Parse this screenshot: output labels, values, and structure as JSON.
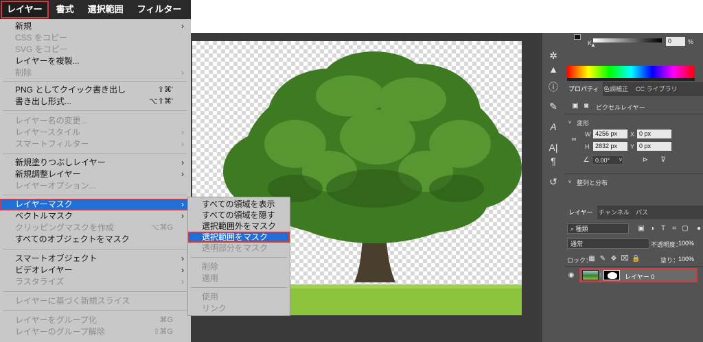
{
  "menubar": [
    "レイヤー",
    "書式",
    "選択範囲",
    "フィルター"
  ],
  "menu": {
    "items": [
      {
        "label": "新規",
        "shortcut": "",
        "arrow": true,
        "disabled": false
      },
      {
        "label": "CSS をコピー",
        "shortcut": "",
        "arrow": false,
        "disabled": true
      },
      {
        "label": "SVG をコピー",
        "shortcut": "",
        "arrow": false,
        "disabled": true
      },
      {
        "label": "レイヤーを複製...",
        "shortcut": "",
        "arrow": false,
        "disabled": false
      },
      {
        "label": "削除",
        "shortcut": "",
        "arrow": true,
        "disabled": true
      },
      {
        "label": "PNG としてクイック書き出し",
        "shortcut": "⇧⌘'",
        "arrow": false,
        "disabled": false
      },
      {
        "label": "書き出し形式...",
        "shortcut": "⌥⇧⌘'",
        "arrow": false,
        "disabled": false
      },
      {
        "label": "レイヤー名の変更...",
        "shortcut": "",
        "arrow": false,
        "disabled": true
      },
      {
        "label": "レイヤースタイル",
        "shortcut": "",
        "arrow": true,
        "disabled": true
      },
      {
        "label": "スマートフィルター",
        "shortcut": "",
        "arrow": true,
        "disabled": true
      },
      {
        "label": "新規塗りつぶしレイヤー",
        "shortcut": "",
        "arrow": true,
        "disabled": false
      },
      {
        "label": "新規調整レイヤー",
        "shortcut": "",
        "arrow": true,
        "disabled": false
      },
      {
        "label": "レイヤーオプション...",
        "shortcut": "",
        "arrow": false,
        "disabled": true
      },
      {
        "label": "レイヤーマスク",
        "shortcut": "",
        "arrow": true,
        "disabled": false
      },
      {
        "label": "ベクトルマスク",
        "shortcut": "",
        "arrow": true,
        "disabled": false
      },
      {
        "label": "クリッピングマスクを作成",
        "shortcut": "⌥⌘G",
        "arrow": false,
        "disabled": true
      },
      {
        "label": "すべてのオブジェクトをマスク",
        "shortcut": "",
        "arrow": false,
        "disabled": false
      },
      {
        "label": "スマートオブジェクト",
        "shortcut": "",
        "arrow": true,
        "disabled": false
      },
      {
        "label": "ビデオレイヤー",
        "shortcut": "",
        "arrow": true,
        "disabled": false
      },
      {
        "label": "ラスタライズ",
        "shortcut": "",
        "arrow": true,
        "disabled": true
      },
      {
        "label": "レイヤーに基づく新規スライス",
        "shortcut": "",
        "arrow": false,
        "disabled": true
      },
      {
        "label": "レイヤーをグループ化",
        "shortcut": "⌘G",
        "arrow": false,
        "disabled": true
      },
      {
        "label": "レイヤーのグループ解除",
        "shortcut": "⇧⌘G",
        "arrow": false,
        "disabled": true
      }
    ]
  },
  "submenu": {
    "items": [
      {
        "label": "すべての領域を表示",
        "disabled": false
      },
      {
        "label": "すべての領域を隠す",
        "disabled": false
      },
      {
        "label": "選択範囲外をマスク",
        "disabled": false
      },
      {
        "label": "選択範囲をマスク",
        "disabled": false
      },
      {
        "label": "透明部分をマスク",
        "disabled": true
      },
      {
        "label": "削除",
        "disabled": true
      },
      {
        "label": "適用",
        "disabled": true
      },
      {
        "label": "使用",
        "disabled": true
      },
      {
        "label": "リンク",
        "disabled": true
      }
    ]
  },
  "color_panel": {
    "channel": "K",
    "value": "0",
    "unit": "%"
  },
  "properties": {
    "tabs": [
      "プロパティ",
      "色調補正",
      "CC ライブラリ"
    ],
    "layer_type": "ピクセルレイヤー",
    "transform_title": "変形",
    "w_label": "W",
    "w_value": "4256 px",
    "x_label": "X",
    "x_value": "0 px",
    "h_label": "H",
    "h_value": "2832 px",
    "y_label": "Y",
    "y_value": "0 px",
    "angle_value": "0.00°",
    "align_title": "整列と分布"
  },
  "layers": {
    "tabs": [
      "レイヤー",
      "チャンネル",
      "パス"
    ],
    "filter_label": "種類",
    "blend_mode": "通常",
    "opacity_label": "不透明度：",
    "opacity_value": "100%",
    "lock_label": "ロック：",
    "fill_label": "塗り：",
    "fill_value": "100%",
    "layer_name": "レイヤー 0"
  }
}
